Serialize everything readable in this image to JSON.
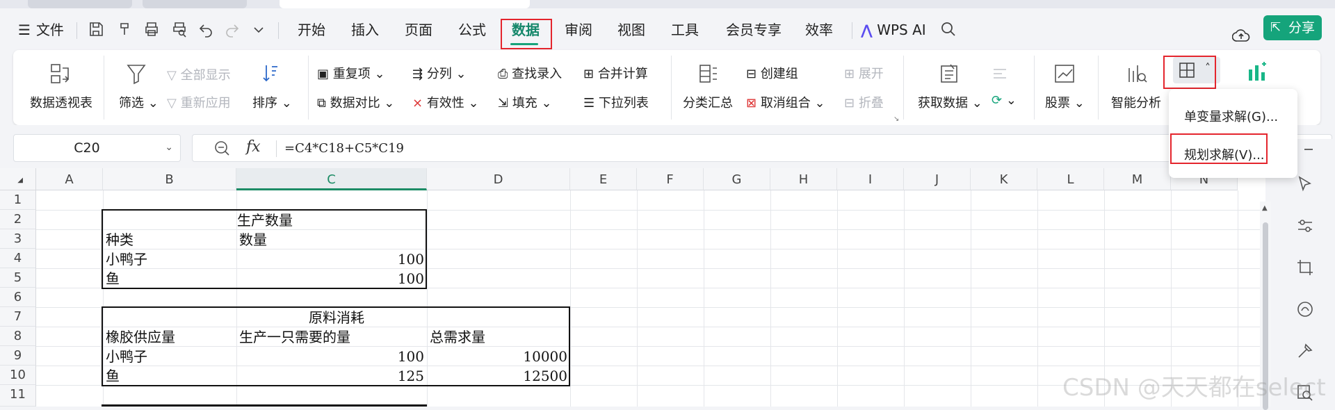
{
  "menubar": {
    "file": "文件",
    "tabs": [
      "开始",
      "插入",
      "页面",
      "公式",
      "数据",
      "审阅",
      "视图",
      "工具",
      "会员专享",
      "效率"
    ],
    "active_tab": "数据",
    "wps_ai": "WPS AI",
    "share": "分享"
  },
  "ribbon": {
    "pivot": "数据透视表",
    "filter": "筛选",
    "show_all": "全部显示",
    "reapply": "重新应用",
    "sort": "排序",
    "duplicates": "重复项",
    "compare": "数据对比",
    "split": "分列",
    "validity": "有效性",
    "lookup_entry": "查找录入",
    "fill": "填充",
    "merge_calc": "合并计算",
    "dropdown_list": "下拉列表",
    "subtotal": "分类汇总",
    "create_group": "创建组",
    "ungroup": "取消组合",
    "expand": "展开",
    "collapse": "折叠",
    "get_data": "获取数据",
    "stocks": "股票",
    "smart_analysis": "智能分析"
  },
  "whatif_menu": {
    "items": [
      "单变量求解(G)...",
      "规划求解(V)..."
    ]
  },
  "formula_bar": {
    "cell_ref": "C20",
    "fx": "fx",
    "formula": "=C4*C18+C5*C19"
  },
  "sheet": {
    "columns": [
      "A",
      "B",
      "C",
      "D",
      "E",
      "F",
      "G",
      "H",
      "I",
      "J",
      "K",
      "L",
      "M",
      "N"
    ],
    "selected_column": "C",
    "rows": [
      "1",
      "2",
      "3",
      "4",
      "5",
      "6",
      "7",
      "8",
      "9",
      "10",
      "11"
    ],
    "table1": {
      "title": "生产数量",
      "headers": [
        "种类",
        "数量"
      ],
      "rows": [
        [
          "小鸭子",
          "100"
        ],
        [
          "鱼",
          "100"
        ]
      ]
    },
    "table2": {
      "title": "原料消耗",
      "headers": [
        "橡胶供应量",
        "生产一只需要的量",
        "总需求量"
      ],
      "rows": [
        [
          "小鸭子",
          "100",
          "10000"
        ],
        [
          "鱼",
          "125",
          "12500"
        ]
      ]
    }
  },
  "watermark": "CSDN @天天都在select",
  "colors": {
    "accent": "#15a47b",
    "highlight": "#e4252d"
  }
}
